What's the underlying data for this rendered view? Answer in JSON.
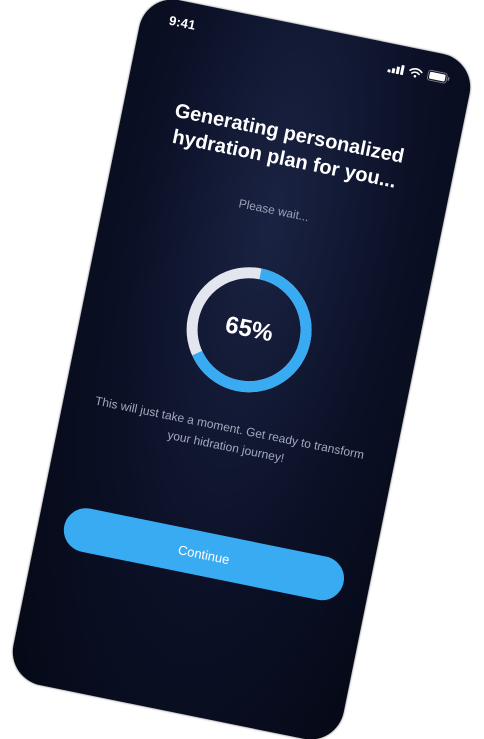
{
  "status_bar": {
    "time": "9:41",
    "icons": [
      "signal-icon",
      "wifi-icon",
      "battery-icon"
    ]
  },
  "screen": {
    "title": "Generating personalized hydration plan for you...",
    "subtitle": "Please wait...",
    "progress": {
      "percent": 65,
      "label": "65%"
    },
    "info_text": "This will just take a moment. Get ready to transform your hidration journey!",
    "continue_label": "Continue"
  },
  "colors": {
    "background": "#0b1026",
    "accent": "#38abf3",
    "progress_track": "#e3e6ee",
    "text_primary": "#ffffff",
    "text_secondary": "#9aa1b6"
  }
}
